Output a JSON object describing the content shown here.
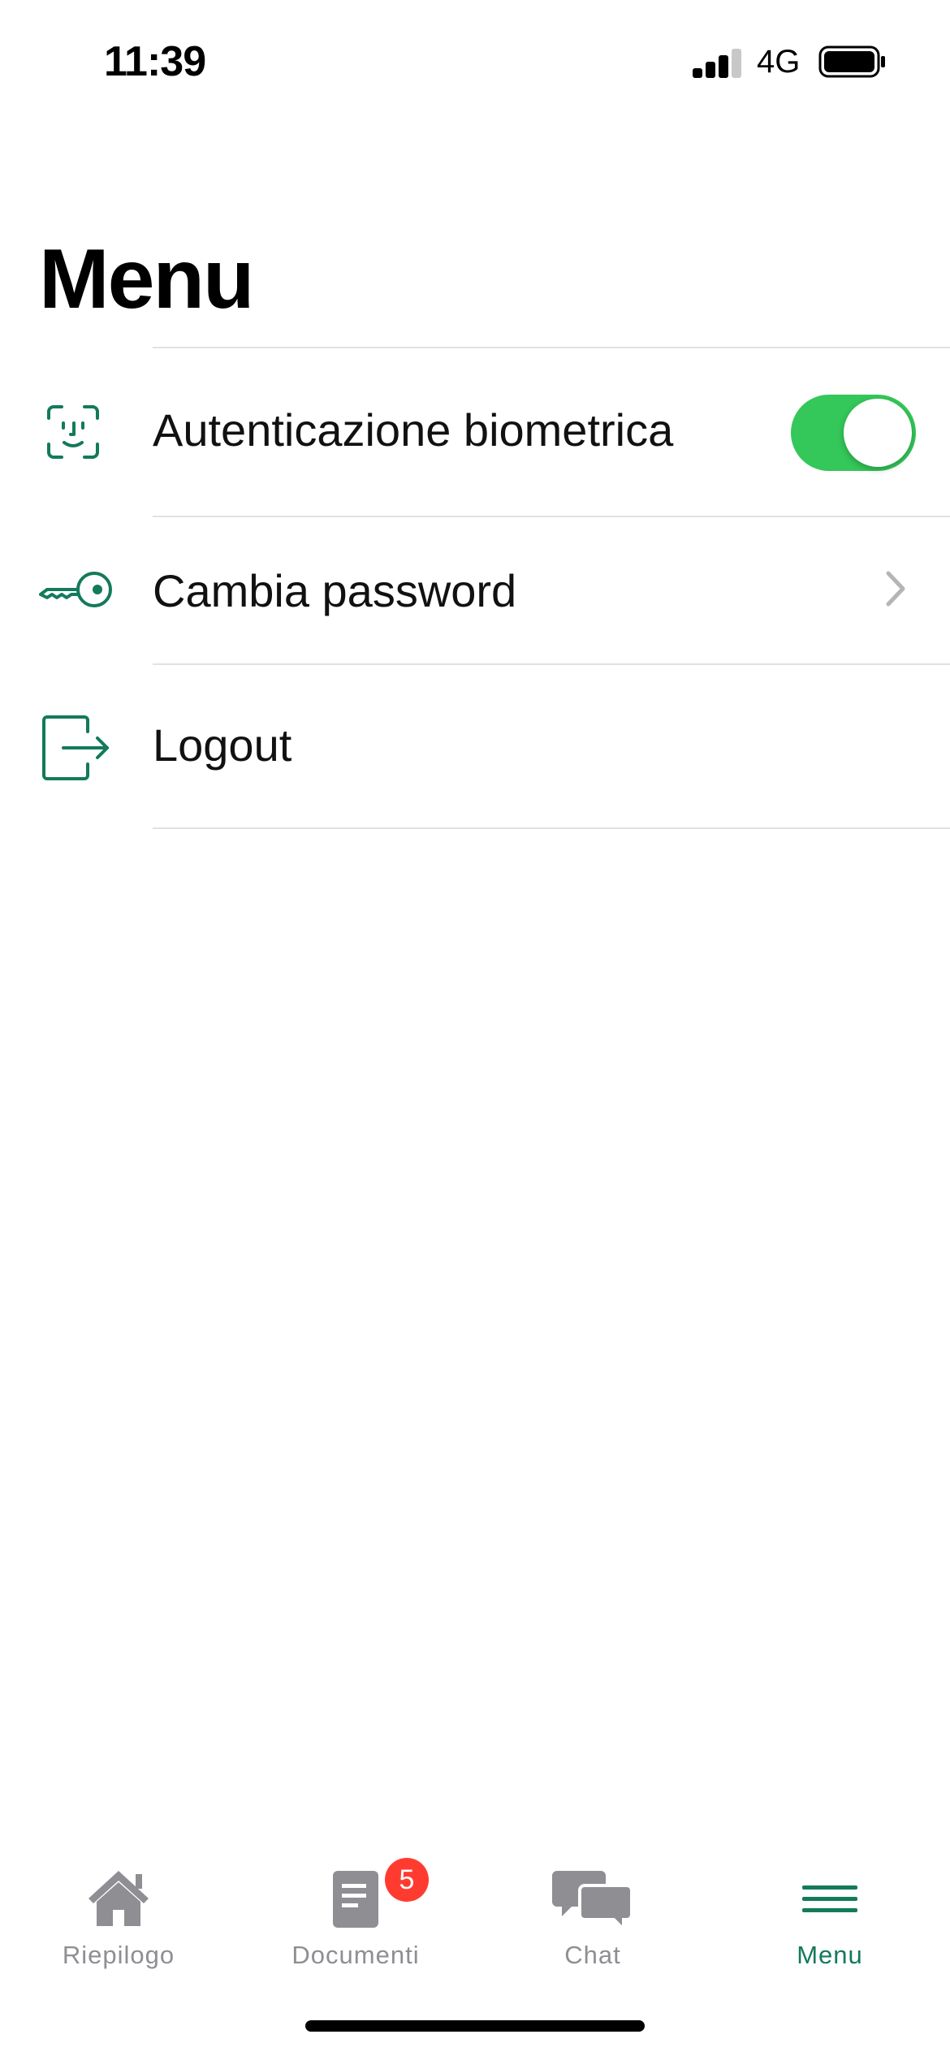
{
  "status_bar": {
    "time": "11:39",
    "network": "4G"
  },
  "page": {
    "title": "Menu"
  },
  "menu": {
    "items": [
      {
        "label": "Autenticazione biometrica",
        "icon": "face-id-icon",
        "control": "toggle",
        "toggle_on": true
      },
      {
        "label": "Cambia password",
        "icon": "key-icon",
        "control": "chevron"
      },
      {
        "label": "Logout",
        "icon": "logout-icon",
        "control": "none"
      }
    ]
  },
  "tab_bar": {
    "tabs": [
      {
        "label": "Riepilogo",
        "icon": "home-icon"
      },
      {
        "label": "Documenti",
        "icon": "document-icon",
        "badge": "5"
      },
      {
        "label": "Chat",
        "icon": "chat-icon"
      },
      {
        "label": "Menu",
        "icon": "menu-icon",
        "active": true
      }
    ]
  },
  "colors": {
    "accent": "#137a5b",
    "toggle_on": "#34c759",
    "badge": "#ff3b30",
    "tab_inactive": "#8e8e93"
  }
}
